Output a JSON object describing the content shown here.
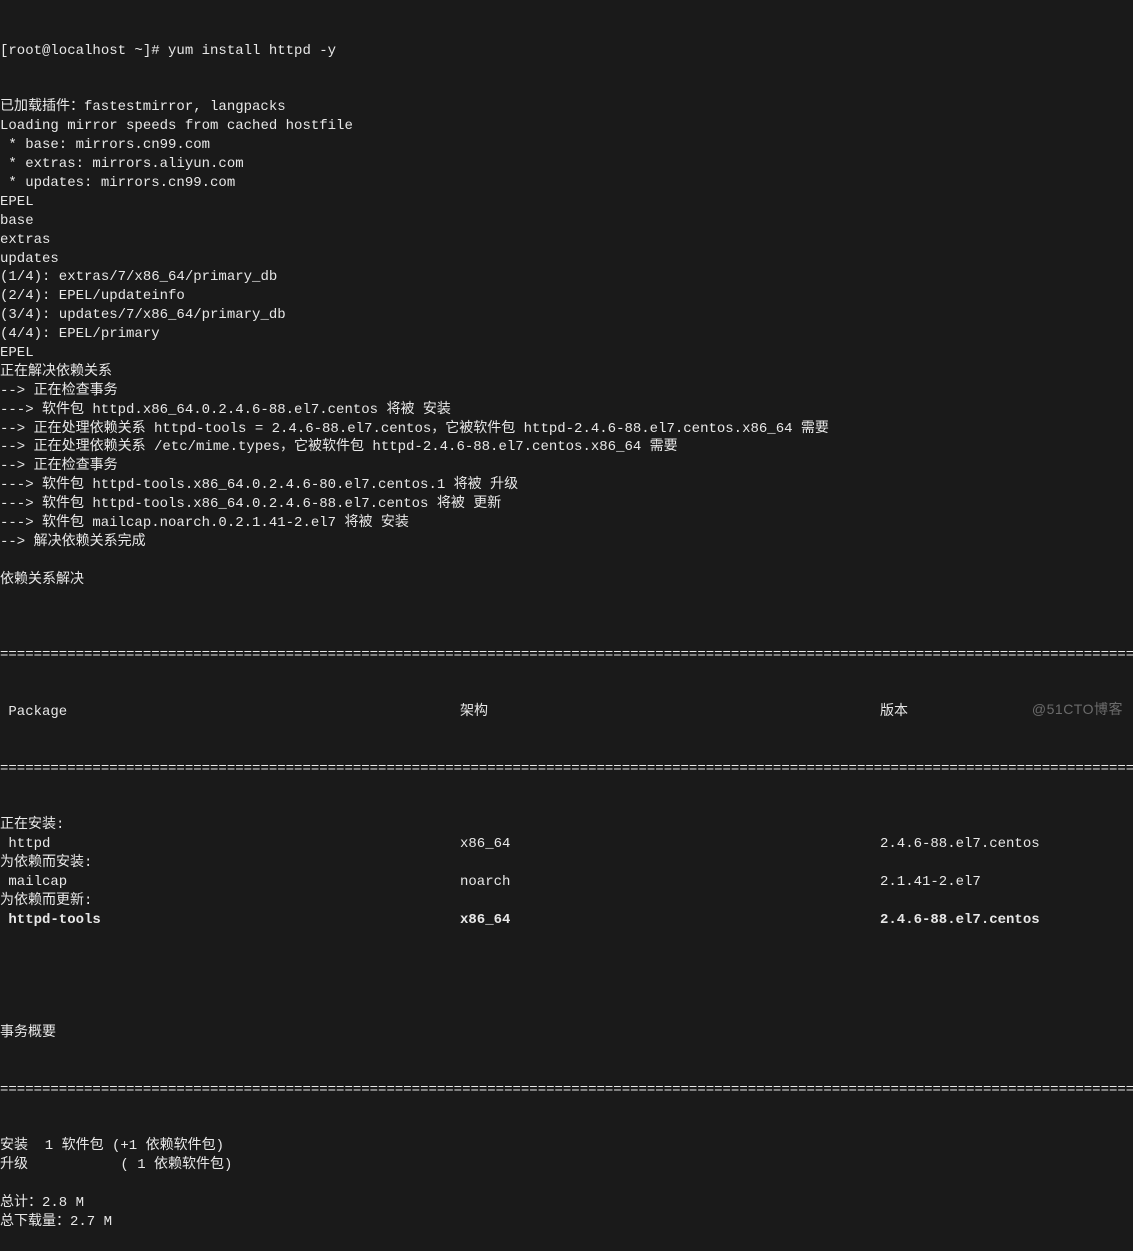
{
  "prompt": "[root@localhost ~]# yum install httpd -y",
  "preamble": [
    "已加载插件：fastestmirror, langpacks",
    "Loading mirror speeds from cached hostfile",
    " * base: mirrors.cn99.com",
    " * extras: mirrors.aliyun.com",
    " * updates: mirrors.cn99.com",
    "EPEL",
    "base",
    "extras",
    "updates",
    "(1/4): extras/7/x86_64/primary_db",
    "(2/4): EPEL/updateinfo",
    "(3/4): updates/7/x86_64/primary_db",
    "(4/4): EPEL/primary",
    "EPEL",
    "正在解决依赖关系",
    "--> 正在检查事务",
    "---> 软件包 httpd.x86_64.0.2.4.6-88.el7.centos 将被 安装",
    "--> 正在处理依赖关系 httpd-tools = 2.4.6-88.el7.centos，它被软件包 httpd-2.4.6-88.el7.centos.x86_64 需要",
    "--> 正在处理依赖关系 /etc/mime.types，它被软件包 httpd-2.4.6-88.el7.centos.x86_64 需要",
    "--> 正在检查事务",
    "---> 软件包 httpd-tools.x86_64.0.2.4.6-80.el7.centos.1 将被 升级",
    "---> 软件包 httpd-tools.x86_64.0.2.4.6-88.el7.centos 将被 更新",
    "---> 软件包 mailcap.noarch.0.2.1.41-2.el7 将被 安装",
    "--> 解决依赖关系完成",
    "",
    "依赖关系解决",
    ""
  ],
  "table": {
    "header": {
      "pkg": " Package",
      "arch": "架构",
      "ver": "版本"
    },
    "sections": [
      {
        "title": "正在安装:",
        "rows": [
          {
            "pkg": " httpd",
            "arch": "x86_64",
            "ver": "2.4.6-88.el7.centos",
            "bold": false
          }
        ]
      },
      {
        "title": "为依赖而安装:",
        "rows": [
          {
            "pkg": " mailcap",
            "arch": "noarch",
            "ver": "2.1.41-2.el7",
            "bold": false
          }
        ]
      },
      {
        "title": "为依赖而更新:",
        "rows": [
          {
            "pkg": " httpd-tools",
            "arch": "x86_64",
            "ver": "2.4.6-88.el7.centos",
            "bold": true
          }
        ]
      }
    ]
  },
  "summary_title": "事务概要",
  "summary_lines": [
    "安装  1 软件包 (+1 依赖软件包)",
    "升级           ( 1 依赖软件包)",
    "",
    "总计：2.8 M",
    "总下载量：2.7 M"
  ],
  "watermark": "@51CTO博客"
}
